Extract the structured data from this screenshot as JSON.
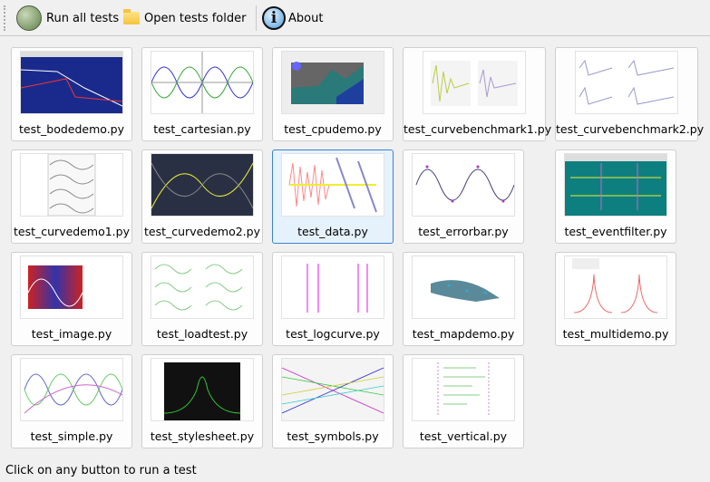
{
  "toolbar": {
    "run_all": {
      "label": "Run all tests",
      "icon": "run-icon"
    },
    "open_folder": {
      "label": "Open tests folder",
      "icon": "folder-icon"
    },
    "about": {
      "label": "About",
      "icon": "info-icon"
    }
  },
  "tests": [
    {
      "label": "test_bodedemo.py"
    },
    {
      "label": "test_cartesian.py"
    },
    {
      "label": "test_cpudemo.py"
    },
    {
      "label": "test_curvebenchmark1.py"
    },
    {
      "label": "test_curvebenchmark2.py"
    },
    {
      "label": "test_curvedemo1.py"
    },
    {
      "label": "test_curvedemo2.py"
    },
    {
      "label": "test_data.py",
      "selected": true
    },
    {
      "label": "test_errorbar.py"
    },
    {
      "label": "test_eventfilter.py"
    },
    {
      "label": "test_image.py"
    },
    {
      "label": "test_loadtest.py"
    },
    {
      "label": "test_logcurve.py"
    },
    {
      "label": "test_mapdemo.py"
    },
    {
      "label": "test_multidemo.py"
    },
    {
      "label": "test_simple.py"
    },
    {
      "label": "test_stylesheet.py"
    },
    {
      "label": "test_symbols.py"
    },
    {
      "label": "test_vertical.py"
    }
  ],
  "status": "Click on any button to run a test"
}
